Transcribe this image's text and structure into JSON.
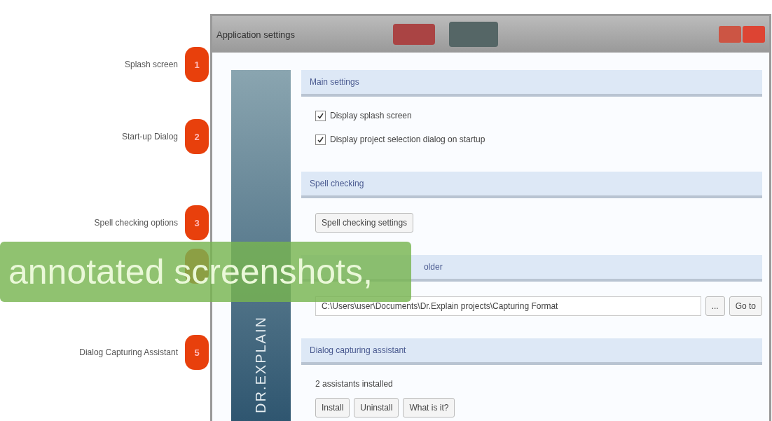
{
  "annotations": [
    {
      "kind": "callout",
      "label": "Splash screen",
      "number": "1"
    },
    {
      "kind": "callout",
      "label": "Start-up Dialog",
      "number": "2"
    },
    {
      "kind": "callout",
      "label": "Spell checking options",
      "number": "3"
    },
    {
      "kind": "covered"
    },
    {
      "kind": "callout",
      "label": "Dialog Capturing Assistant",
      "number": "5"
    }
  ],
  "window": {
    "title": "Application settings"
  },
  "sidebar": {
    "logo": "DR.EXPLAIN"
  },
  "sections": [
    {
      "title": "Main settings",
      "items": [
        {
          "kind": "checkbox",
          "label": "Display splash screen",
          "checked": true
        },
        {
          "kind": "checkbox",
          "label": "Display project selection dialog on startup",
          "checked": true
        }
      ]
    },
    {
      "title": "Spell checking",
      "items": [
        {
          "kind": "button",
          "label": "Spell checking settings"
        }
      ]
    },
    {
      "title": "older",
      "items": [
        {
          "kind": "path",
          "value": "C:\\Users\\user\\Documents\\Dr.Explain projects\\Capturing Format",
          "buttons": [
            "...",
            "Go to"
          ]
        }
      ]
    },
    {
      "title": "Dialog capturing assistant",
      "items": [
        {
          "kind": "text",
          "label": "2 assistants installed"
        },
        {
          "kind": "buttons",
          "buttons": [
            "Install",
            "Uninstall",
            "What is it?"
          ]
        }
      ]
    }
  ],
  "caption": "annotated screenshots,"
}
